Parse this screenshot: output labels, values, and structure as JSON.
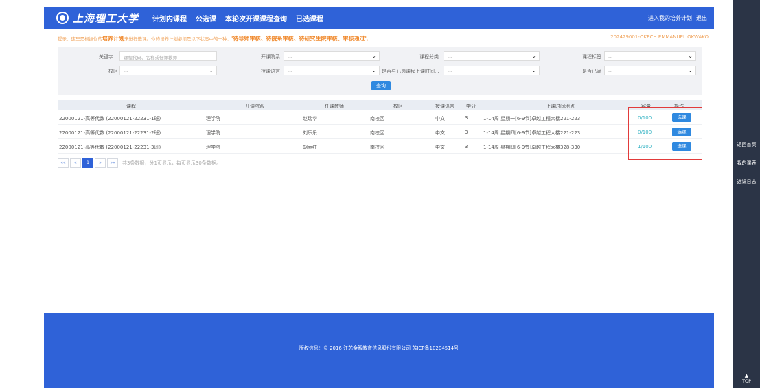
{
  "header": {
    "school_name": "上海理工大学",
    "nav": [
      "计划内课程",
      "公选课",
      "本轮次开课课程查询",
      "已选课程"
    ],
    "right_links": [
      "进入我的培养计划",
      "退出"
    ]
  },
  "notice": {
    "prefix": "提示：这里是根据你的",
    "highlight1": "培养计划",
    "middle": "来进行选课。你的培养计划必须是以下状态中的一种：",
    "statuses": "'待导师审核、待院系审核、待研究生院审核、审核通过'",
    "suffix": "。"
  },
  "student_id": "202429001-OKECH EMMANUEL OKWAKO",
  "filters": {
    "keyword_label": "关键字",
    "keyword_placeholder": "课程代码、名称或任课教师",
    "dept_label": "开课院系",
    "dept_value": "...",
    "category_label": "课程分类",
    "category_value": "...",
    "tag_label": "课程标签",
    "tag_value": "...",
    "campus_label": "校区",
    "campus_value": "...",
    "language_label": "授课语言",
    "language_value": "...",
    "conflict_label": "是否与已选课程上课时间...",
    "conflict_value": "...",
    "selected_label": "是否已满",
    "selected_value": "...",
    "search_button": "查询"
  },
  "table": {
    "headers": [
      "课程",
      "开课院系",
      "任课教师",
      "校区",
      "授课语言",
      "学分",
      "上课时间地点",
      "容量",
      "操作"
    ],
    "rows": [
      {
        "course": "22000121-高等代数 (22000121-22231-1班)",
        "dept": "理学院",
        "teacher": "赵瑞华",
        "campus": "南校区",
        "lang": "中文",
        "credit": "3",
        "time": "1-14周 星期一[6-9节]卓越工程大楼221-223",
        "capacity": "0/100",
        "action": "选课"
      },
      {
        "course": "22000121-高等代数 (22000121-22231-2班)",
        "dept": "理学院",
        "teacher": "刘乐乐",
        "campus": "南校区",
        "lang": "中文",
        "credit": "3",
        "time": "1-14周 星期四[6-9节]卓越工程大楼221-223",
        "capacity": "0/100",
        "action": "选课"
      },
      {
        "course": "22000121-高等代数 (22000121-22231-3班)",
        "dept": "理学院",
        "teacher": "胡丽红",
        "campus": "南校区",
        "lang": "中文",
        "credit": "3",
        "time": "1-14周 星期四[6-9节]卓越工程大楼328-330",
        "capacity": "1/100",
        "action": "选课"
      }
    ]
  },
  "pager": {
    "first": "««",
    "prev": "«",
    "current": "1",
    "next": "»",
    "last": "»»",
    "info": "共3条数据，分1页显示，每页显示30条数据。"
  },
  "footer": {
    "copyright": "版权信息：© 2016 江苏金智教育信息股份有限公司 苏ICP备10204514号"
  },
  "sidebar": {
    "links": [
      "返回首页",
      "我的课表",
      "选课日志"
    ],
    "top": "TOP"
  }
}
